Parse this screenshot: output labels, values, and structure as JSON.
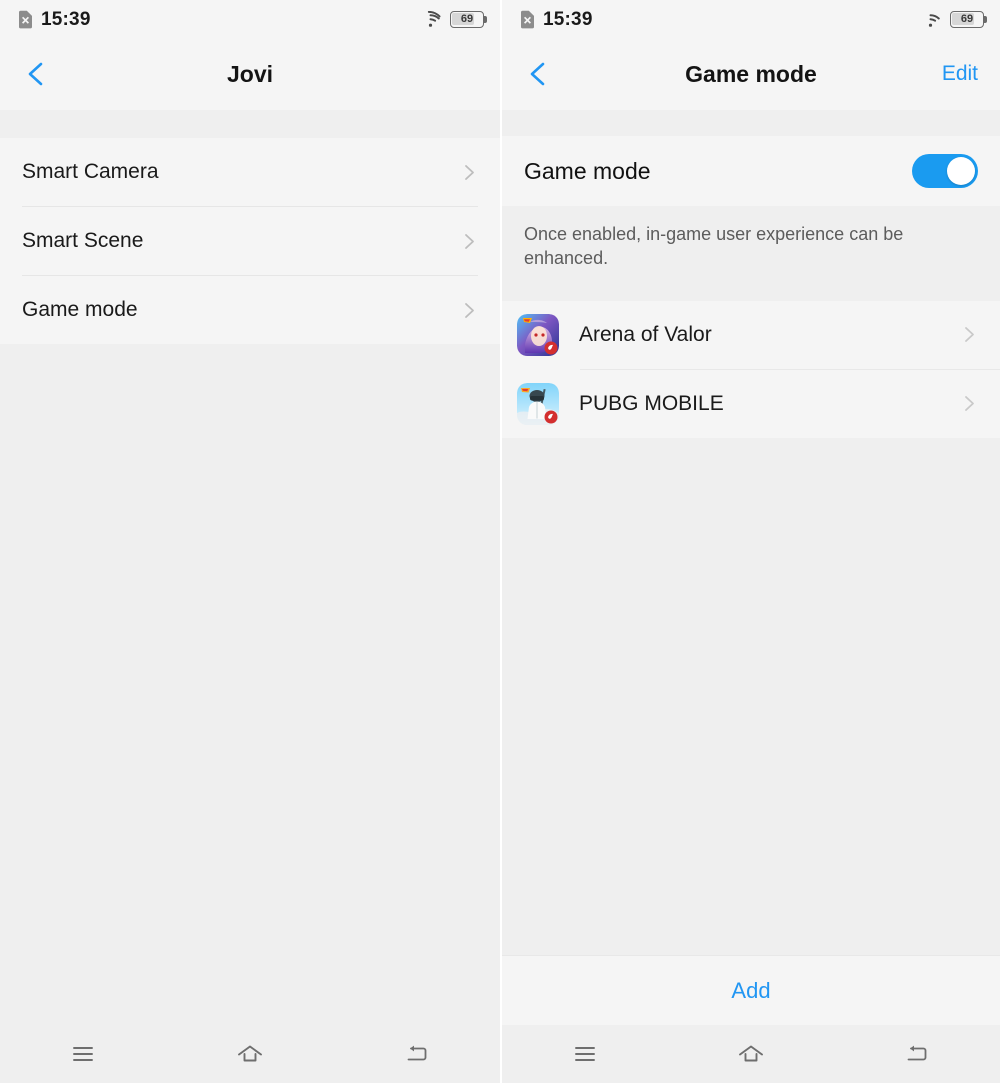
{
  "statusbar": {
    "time": "15:39",
    "sim_icon": "sim-card-no-service-icon",
    "wifi_icon": "wifi-icon",
    "battery_icon": "battery-icon",
    "battery_level": "69"
  },
  "left_screen": {
    "header": {
      "back_icon": "back-chevron-icon",
      "title": "Jovi"
    },
    "items": [
      {
        "label": "Smart Camera",
        "chevron": "chevron-right-icon"
      },
      {
        "label": "Smart Scene",
        "chevron": "chevron-right-icon"
      },
      {
        "label": "Game mode",
        "chevron": "chevron-right-icon"
      }
    ]
  },
  "right_screen": {
    "header": {
      "back_icon": "back-chevron-icon",
      "title": "Game mode",
      "edit_label": "Edit"
    },
    "toggle": {
      "label": "Game mode",
      "state": "on",
      "accent_color": "#1a9bf0"
    },
    "description": "Once enabled, in-game user experience can be enhanced.",
    "games": [
      {
        "name": "Arena of Valor",
        "icon": "arena-of-valor-app-icon",
        "chevron": "chevron-right-icon"
      },
      {
        "name": "PUBG MOBILE",
        "icon": "pubg-mobile-app-icon",
        "chevron": "chevron-right-icon"
      }
    ],
    "add_label": "Add",
    "link_color": "#2196f3"
  },
  "navbar": {
    "recents_icon": "menu-recents-icon",
    "home_icon": "home-icon",
    "back_icon": "back-return-icon"
  }
}
